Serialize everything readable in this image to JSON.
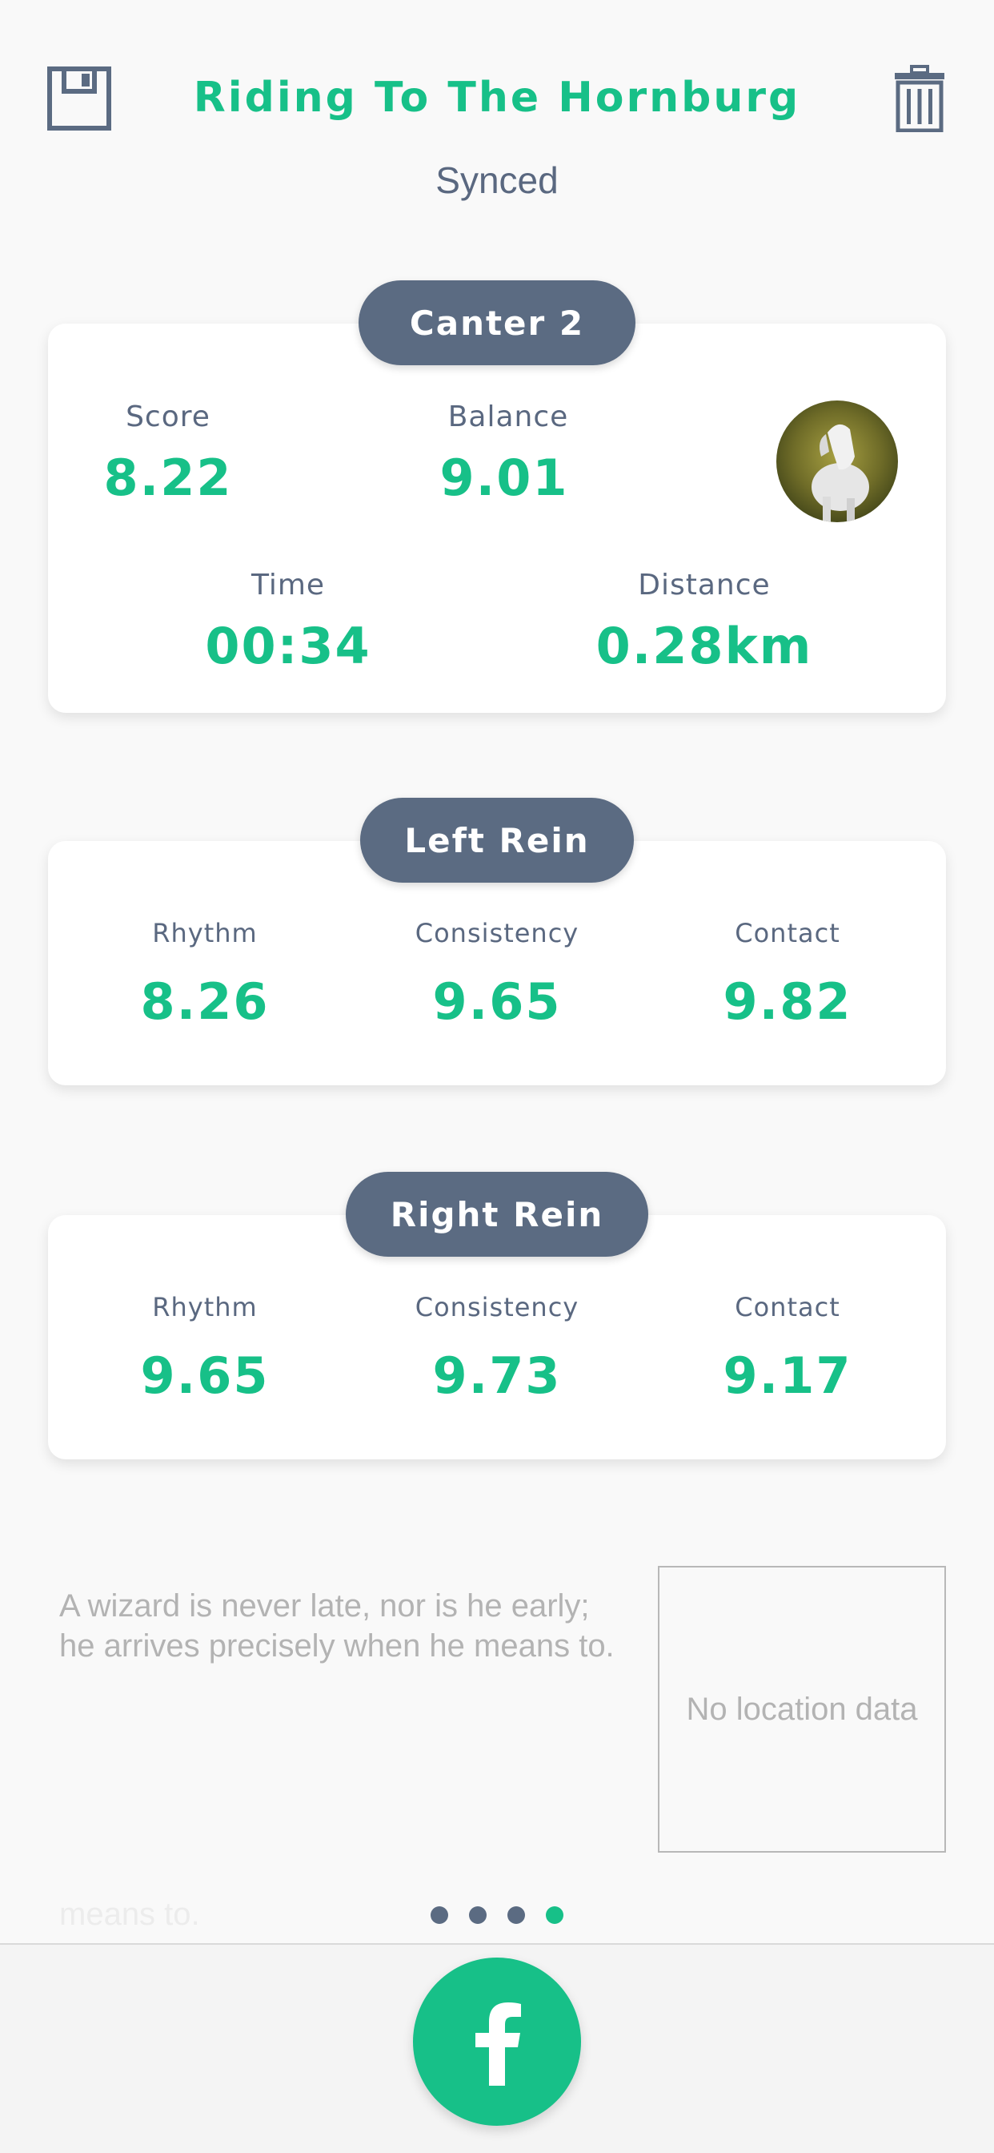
{
  "header": {
    "title": "Riding To The Hornburg",
    "status": "Synced",
    "save_icon": "floppy-disk-icon",
    "delete_icon": "trash-icon"
  },
  "canter": {
    "title": "Canter 2",
    "score_label": "Score",
    "score_value": "8.22",
    "balance_label": "Balance",
    "balance_value": "9.01",
    "time_label": "Time",
    "time_value": "00:34",
    "distance_label": "Distance",
    "distance_value": "0.28km",
    "avatar": "horse-avatar"
  },
  "left_rein": {
    "title": "Left Rein",
    "rhythm_label": "Rhythm",
    "rhythm_value": "8.26",
    "consistency_label": "Consistency",
    "consistency_value": "9.65",
    "contact_label": "Contact",
    "contact_value": "9.82"
  },
  "right_rein": {
    "title": "Right Rein",
    "rhythm_label": "Rhythm",
    "rhythm_value": "9.65",
    "consistency_label": "Consistency",
    "consistency_value": "9.73",
    "contact_label": "Contact",
    "contact_value": "9.17"
  },
  "notes": {
    "quote": "A wizard is never late, nor is he early; he arrives precisely when he means to.",
    "map_placeholder": "No location data",
    "ghost_text": "means to."
  },
  "pager": {
    "count": 4,
    "active_index": 3
  },
  "share": {
    "icon": "facebook-icon",
    "glyph": "f"
  },
  "colors": {
    "accent": "#17c088",
    "slate": "#5b6b82",
    "background": "#f9f9f9"
  }
}
